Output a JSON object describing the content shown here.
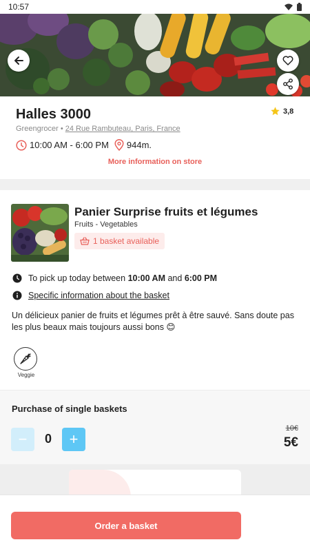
{
  "status_bar": {
    "time": "10:57"
  },
  "store": {
    "name": "Halles 3000",
    "rating": "3,8",
    "category": "Greengrocer",
    "address": "24 Rue Rambuteau, Paris, France",
    "hours": "10:00 AM - 6:00 PM",
    "distance": "944m.",
    "more_info_link": "More information on store"
  },
  "basket": {
    "title": "Panier Surprise fruits et légumes",
    "category": "Fruits - Vegetables",
    "availability": "1 basket available",
    "pickup_prefix": "To pick up today between",
    "pickup_start": "10:00 AM",
    "pickup_and": "and",
    "pickup_end": "6:00 PM",
    "specific_info_link": "Specific information about the basket",
    "description": "Un délicieux panier de fruits et légumes prêt à être sauvé. Sans doute pas les plus beaux mais toujours aussi bons 😊",
    "tag_label": "Veggie"
  },
  "purchase": {
    "title": "Purchase of single baskets",
    "minus": "−",
    "quantity": "0",
    "plus": "+",
    "old_price": "10€",
    "new_price": "5€"
  },
  "footer": {
    "order_button": "Order a basket"
  },
  "colors": {
    "accent_red": "#f16b64",
    "link_red": "#e8605a",
    "stepper_blue": "#5ec7f5",
    "stepper_blue_disabled": "#d2eefb",
    "star_yellow": "#f5c518"
  },
  "icons": [
    "back-arrow-icon",
    "heart-icon",
    "share-icon",
    "star-icon",
    "clock-icon",
    "location-pin-icon",
    "basket-icon",
    "info-icon",
    "carrot-icon",
    "wifi-icon",
    "battery-icon"
  ]
}
